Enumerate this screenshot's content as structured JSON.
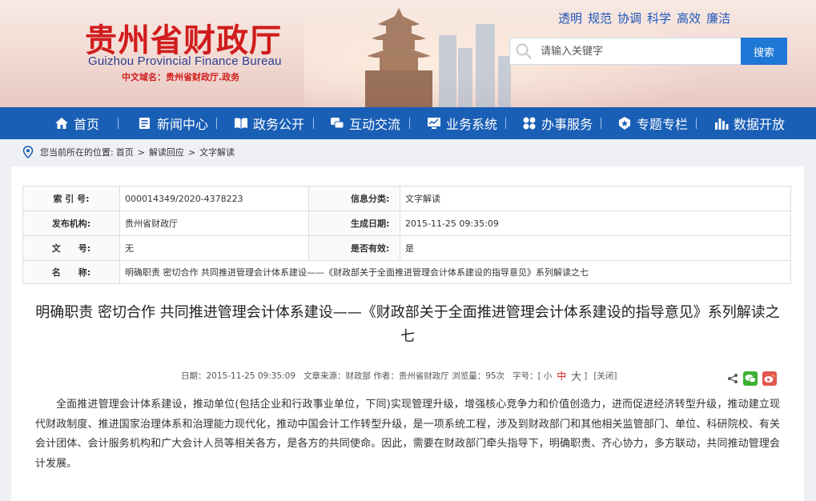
{
  "header": {
    "title": "贵州省财政厅",
    "subtitle": "Guizhou Provincial Finance Bureau",
    "domain": "中文域名：贵州省财政厅.政务",
    "values": [
      "透明",
      "规范",
      "协调",
      "科学",
      "高效",
      "廉洁"
    ],
    "search_placeholder": "请输入关键字",
    "search_button": "搜索"
  },
  "nav": [
    {
      "label": "首页",
      "icon": "home-icon"
    },
    {
      "label": "新闻中心",
      "icon": "news-icon"
    },
    {
      "label": "政务公开",
      "icon": "book-icon"
    },
    {
      "label": "互动交流",
      "icon": "chat-icon"
    },
    {
      "label": "业务系统",
      "icon": "monitor-icon"
    },
    {
      "label": "办事服务",
      "icon": "grid-icon"
    },
    {
      "label": "专题专栏",
      "icon": "badge-icon"
    },
    {
      "label": "数据开放",
      "icon": "data-icon"
    }
  ],
  "breadcrumb": {
    "prefix": "您当前所在的位置:",
    "items": [
      "首页",
      "解读回应",
      "文字解读"
    ],
    "separator": ">"
  },
  "meta": {
    "index_label": "索 引 号:",
    "index_value": "000014349/2020-4378223",
    "category_label": "信息分类:",
    "category_value": "文字解读",
    "publisher_label": "发布机构:",
    "publisher_value": "贵州省财政厅",
    "date_label": "生成日期:",
    "date_value": "2015-11-25 09:35:09",
    "docno_label": "文　　号:",
    "docno_value": "无",
    "valid_label": "是否有效:",
    "valid_value": "是",
    "name_label": "名　　称:",
    "name_value": "明确职责 密切合作 共同推进管理会计体系建设——《财政部关于全面推进管理会计体系建设的指导意见》系列解读之七"
  },
  "article": {
    "title": "明确职责 密切合作 共同推进管理会计体系建设——《财政部关于全面推进管理会计体系建设的指导意见》系列解读之七",
    "date": "日期：2015-11-25 09:35:09",
    "source": "文章来源：财政部 作者：贵州省财政厅 浏览量：95次",
    "font_label": "字号：[",
    "font_small": "小",
    "font_medium": "中",
    "font_large": "大",
    "font_close": "]",
    "close": "[关闭]",
    "body": "全面推进管理会计体系建设，推动单位(包括企业和行政事业单位，下同)实现管理升级，增强核心竞争力和价值创造力，进而促进经济转型升级，推动建立现代财政制度、推进国家治理体系和治理能力现代化，推动中国会计工作转型升级，是一项系统工程，涉及到财政部门和其他相关监管部门、单位、科研院校、有关会计团体、会计服务机构和广大会计人员等相关各方，是各方的共同使命。因此，需要在财政部门牵头指导下，明确职责、齐心协力，多方联动，共同推动管理会计发展。"
  },
  "colors": {
    "brand_red": "#d11d1d",
    "nav_blue": "#1a5fb6",
    "search_blue": "#1e78d6"
  }
}
